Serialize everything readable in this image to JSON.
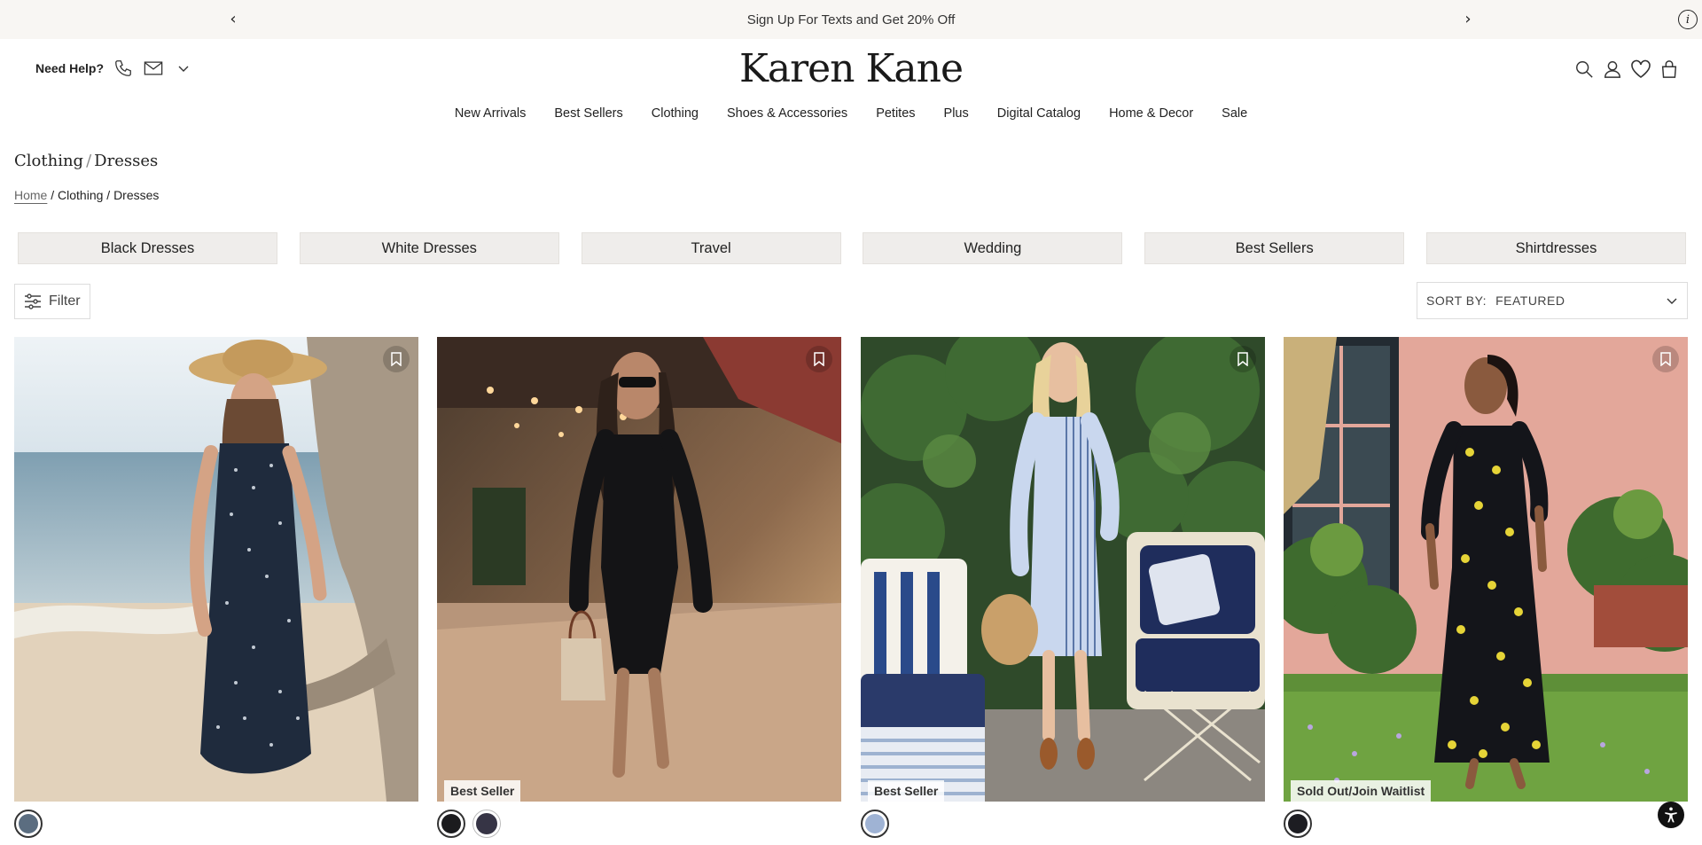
{
  "promo": {
    "message": "Sign Up For Texts and Get 20% Off",
    "prev_symbol": "‹",
    "next_symbol": "›",
    "info_symbol": "i"
  },
  "header": {
    "help_label": "Need Help?",
    "logo": "Karen Kane",
    "icons": [
      "phone-icon",
      "mail-icon",
      "chevron-down-icon",
      "search-icon",
      "account-icon",
      "heart-icon",
      "bag-icon"
    ]
  },
  "nav": {
    "items": [
      "New Arrivals",
      "Best Sellers",
      "Clothing",
      "Shoes & Accessories",
      "Petites",
      "Plus",
      "Digital Catalog",
      "Home & Decor",
      "Sale"
    ]
  },
  "page": {
    "title_parent": "Clothing",
    "title_sep": "/",
    "title_current": "Dresses",
    "breadcrumb": {
      "home": "Home",
      "rest": " / Clothing / Dresses"
    }
  },
  "chips": [
    "Black Dresses",
    "White Dresses",
    "Travel",
    "Wedding",
    "Best Sellers",
    "Shirtdresses"
  ],
  "toolbar": {
    "filter_label": "Filter",
    "sort_label": "SORT BY:",
    "sort_value": "FEATURED"
  },
  "products": [
    {
      "badge": "",
      "swatches": [
        "#5b6d80"
      ],
      "selected_swatch": 0
    },
    {
      "badge": "Best Seller",
      "swatches": [
        "#1b1b1e",
        "#363445"
      ],
      "selected_swatch": 0
    },
    {
      "badge": "Best Seller",
      "swatches": [
        "#9fb3d4"
      ],
      "selected_swatch": 0
    },
    {
      "badge": "Sold Out/Join Waitlist",
      "swatches": [
        "#1d1d22"
      ],
      "selected_swatch": 0
    }
  ],
  "colors": {
    "promo_bg": "#f8f6f3",
    "chip_bg": "#efedeb",
    "text": "#222222"
  }
}
